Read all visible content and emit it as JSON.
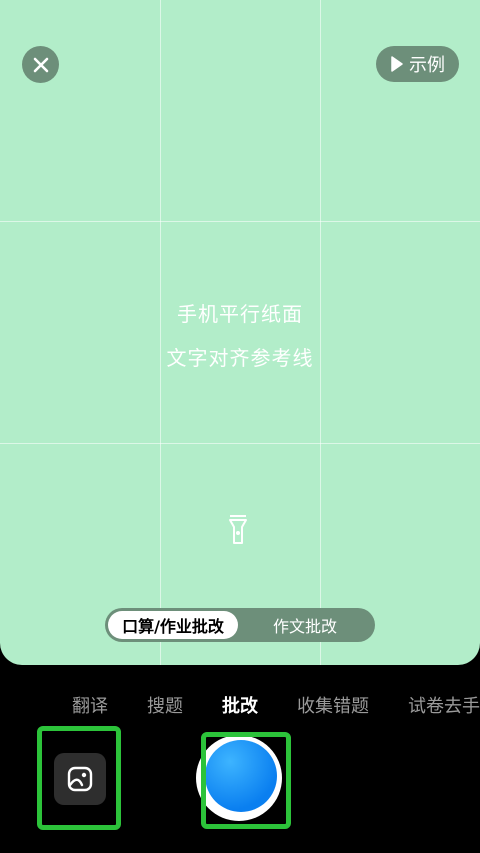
{
  "top_bar": {
    "close_icon": "close-icon",
    "example_label": "示例",
    "example_icon": "play-icon"
  },
  "guide": {
    "line1": "手机平行纸面",
    "line2": "文字对齐参考线"
  },
  "flash_icon": "flashlight-icon",
  "mode_toggle": {
    "options": [
      "口算/作业批改",
      "作文批改"
    ],
    "selected": "口算/作业批改"
  },
  "tabs": {
    "items": [
      "翻译",
      "搜题",
      "批改",
      "收集错题",
      "试卷去手"
    ],
    "active": "批改"
  },
  "bottom": {
    "album_icon": "image-icon",
    "shutter": "shutter-button"
  },
  "colors": {
    "viewfinder": "#b2edc9",
    "overlay_button": "#6d8f7a",
    "highlight": "#2cc33a",
    "shutter": "#0a7ff0"
  }
}
